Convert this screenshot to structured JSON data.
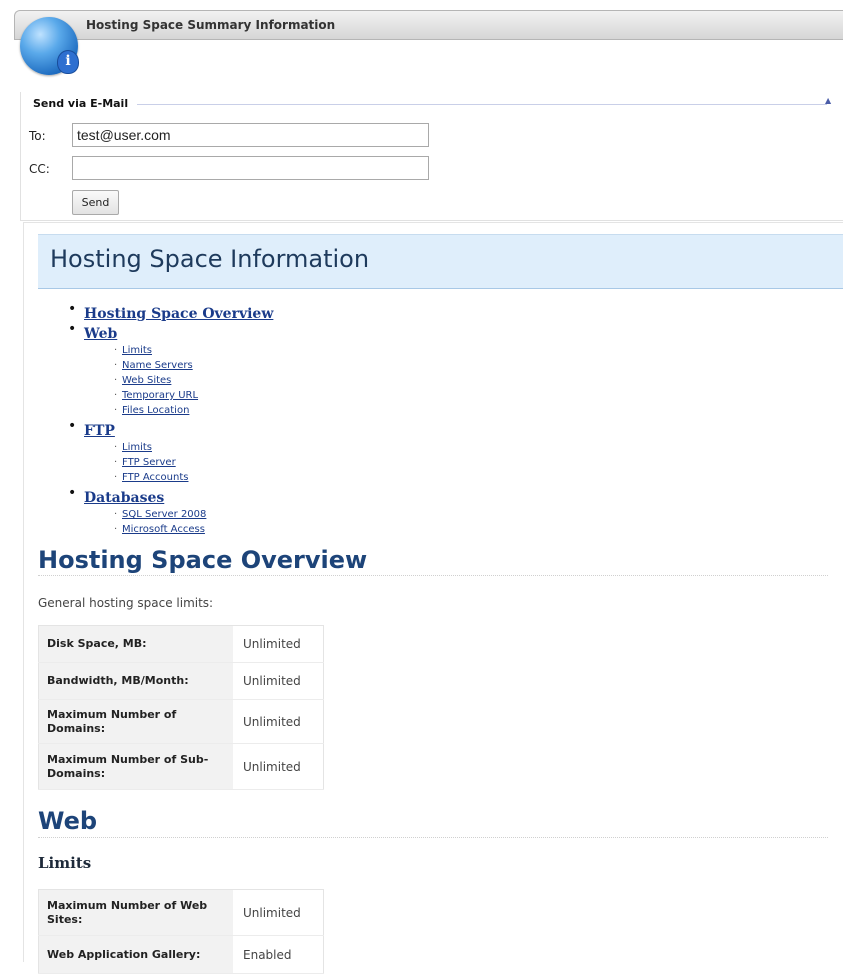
{
  "window": {
    "title": "Hosting Space Summary Information"
  },
  "icons": {
    "header_icon": "info-globe-icon",
    "collapse": "collapse-arrow-icon"
  },
  "email": {
    "legend": "Send via E-Mail",
    "collapse_glyph": "▲",
    "to_label": "To:",
    "to_value": "test@user.com",
    "cc_label": "CC:",
    "cc_value": "",
    "send_label": "Send"
  },
  "report": {
    "title": "Hosting Space Information",
    "toc": [
      {
        "label": "Hosting Space Overview",
        "children": []
      },
      {
        "label": "Web",
        "children": [
          "Limits",
          "Name Servers",
          "Web Sites",
          "Temporary URL",
          "Files Location"
        ]
      },
      {
        "label": "FTP",
        "children": [
          "Limits",
          "FTP Server",
          "FTP Accounts"
        ]
      },
      {
        "label": "Databases",
        "children": [
          "SQL Server 2008",
          "Microsoft Access"
        ]
      }
    ],
    "overview": {
      "heading": "Hosting Space Overview",
      "note": "General hosting space limits:",
      "rows": [
        {
          "k": "Disk Space, MB:",
          "v": "Unlimited"
        },
        {
          "k": "Bandwidth, MB/Month:",
          "v": "Unlimited"
        },
        {
          "k": "Maximum Number of Domains:",
          "v": "Unlimited"
        },
        {
          "k": "Maximum Number of Sub-Domains:",
          "v": "Unlimited"
        }
      ]
    },
    "web": {
      "heading": "Web",
      "limits_heading": "Limits",
      "rows": [
        {
          "k": "Maximum Number of Web Sites:",
          "v": "Unlimited"
        },
        {
          "k": "Web Application Gallery:",
          "v": "Enabled"
        }
      ]
    }
  }
}
